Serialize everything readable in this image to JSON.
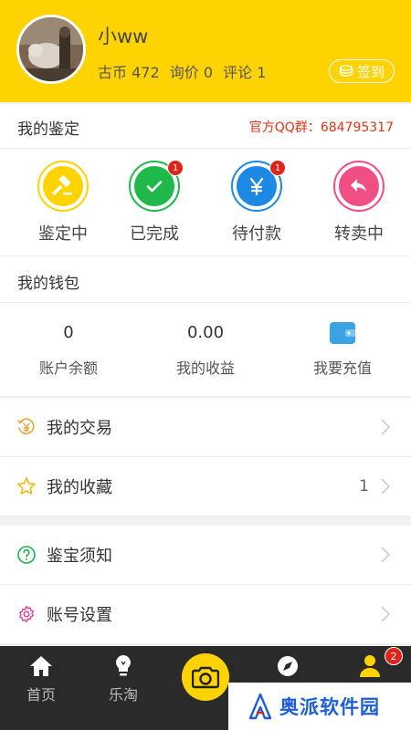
{
  "profile": {
    "username": "小ww",
    "coins_label": "古币 472",
    "inquiry_label": "询价 0",
    "comment_label": "评论 1",
    "signin_label": "签到"
  },
  "appraisal": {
    "title": "我的鉴定",
    "qq_group": "官方QQ群：684795317",
    "statuses": [
      {
        "label": "鉴定中",
        "color": "#ffd300",
        "icon": "hammer-icon",
        "badge": ""
      },
      {
        "label": "已完成",
        "color": "#1fb84a",
        "icon": "check-icon",
        "badge": "1"
      },
      {
        "label": "待付款",
        "color": "#1e88e5",
        "icon": "yen-icon",
        "badge": "1"
      },
      {
        "label": "转卖中",
        "color": "#ef4f82",
        "icon": "return-arrow-icon",
        "badge": ""
      }
    ]
  },
  "wallet": {
    "title": "我的钱包",
    "balance_value": "0",
    "balance_label": "账户余额",
    "earnings_value": "0.00",
    "earnings_label": "我的收益",
    "recharge_label": "我要充值"
  },
  "menu": {
    "trade_label": "我的交易",
    "favorites_label": "我的收藏",
    "favorites_count": "1",
    "notice_label": "鉴宝须知",
    "settings_label": "账号设置"
  },
  "tabbar": {
    "home_label": "首页",
    "shop_label": "乐淘",
    "profile_badge": "2"
  },
  "watermark": {
    "text": "奥派软件园"
  },
  "colors": {
    "brand_yellow": "#ffd300",
    "badge_red": "#e0241a",
    "qq_red": "#d9361a"
  }
}
